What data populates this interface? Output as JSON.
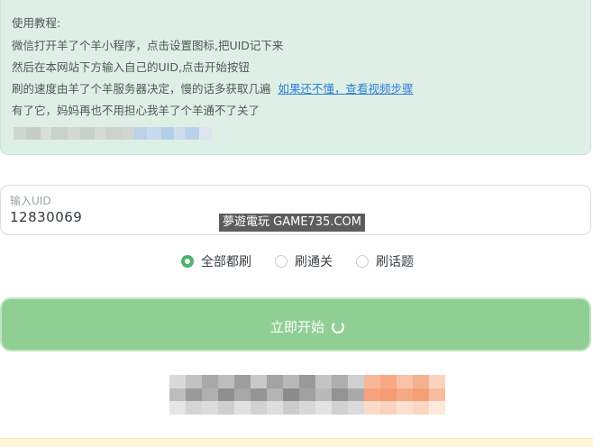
{
  "tutorial": {
    "heading": "使用教程:",
    "line1": "微信打开羊了个羊小程序，点击设置图标,把UID记下来",
    "line2": "然后在本网站下方输入自己的UID,点击开始按钮",
    "line3": "刷的速度由羊了个羊服务器决定，慢的话多获取几遍",
    "link": "如果还不懂，查看视频步骤",
    "line4": "有了它，妈妈再也不用担心我羊了个羊通不了关了"
  },
  "uid": {
    "label": "输入UID",
    "value": "12830069"
  },
  "watermark": "夢遊電玩 GAME735.COM",
  "modes": {
    "options": [
      "全部都刷",
      "刷通关",
      "刷话题"
    ],
    "selected": "全部都刷"
  },
  "start_button": {
    "label": "立即开始"
  },
  "colors": {
    "tutorial_bg": "#deefe5",
    "link": "#2f7fd8",
    "accent_green": "#4fb26a",
    "button_bg": "#8fcf93",
    "notice_bg": "#fdf5d9"
  },
  "icons": {
    "spinner": "loading-spinner-icon"
  }
}
